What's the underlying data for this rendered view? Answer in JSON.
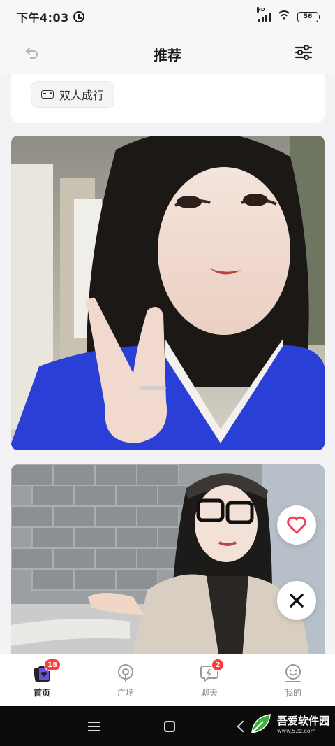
{
  "status_bar": {
    "time": "下午4:03",
    "network": "HD",
    "battery": "56"
  },
  "header": {
    "title": "推荐"
  },
  "tag": {
    "label": "双人成行"
  },
  "tabs": [
    {
      "label": "首页",
      "badge": "18",
      "active": true
    },
    {
      "label": "广场",
      "badge": "",
      "active": false
    },
    {
      "label": "聊天",
      "badge": "2",
      "active": false
    },
    {
      "label": "我的",
      "badge": "",
      "active": false
    }
  ],
  "watermark": {
    "text": "吾爱软件园",
    "url": "www.52z.com"
  },
  "colors": {
    "accent": "#ff3b5c",
    "badge": "#ff3b3b",
    "sweater": "#2a3fd6"
  }
}
